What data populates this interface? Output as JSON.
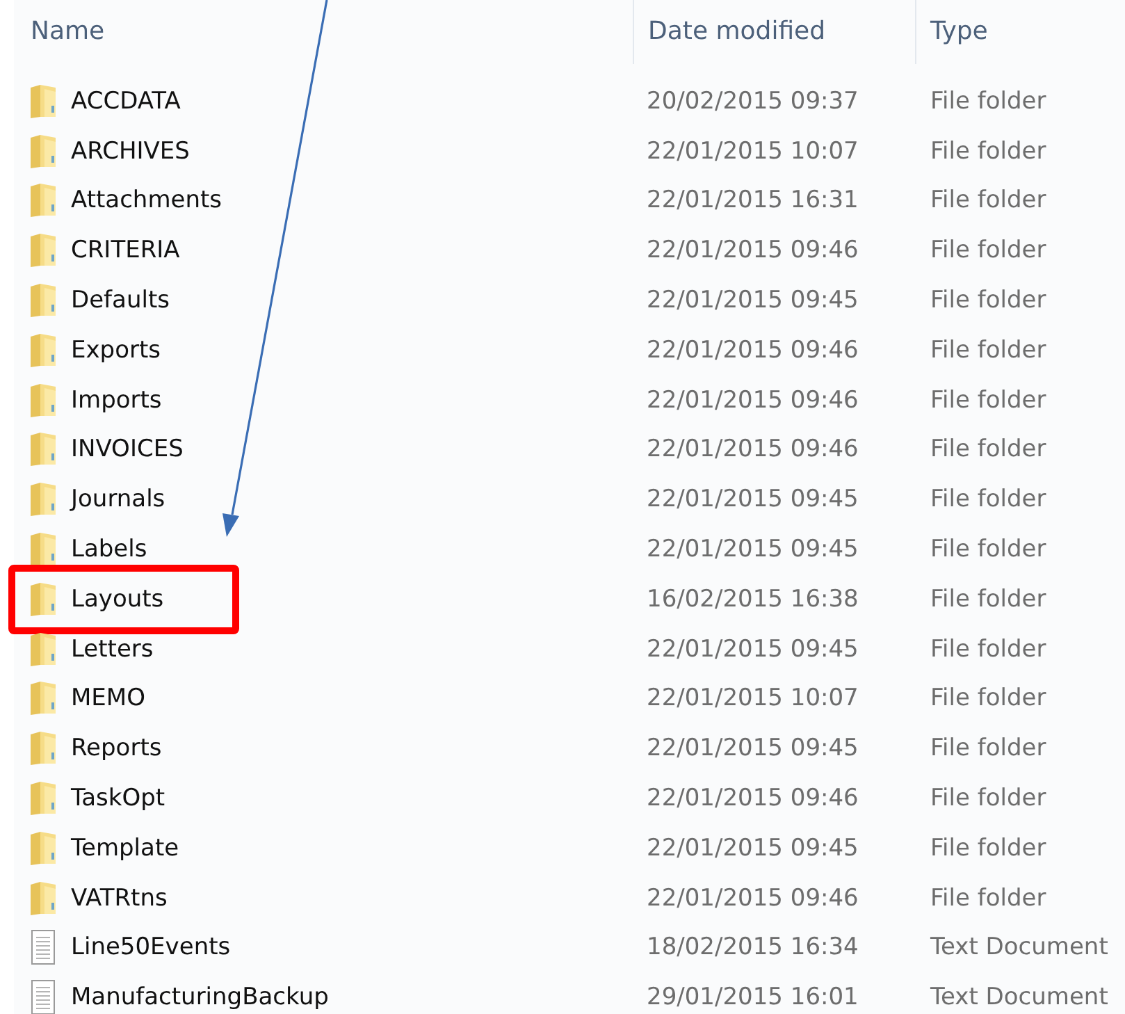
{
  "columns": [
    "Name",
    "Date modified",
    "Type"
  ],
  "rows": [
    {
      "kind": "folder",
      "name": "ACCDATA",
      "date": "20/02/2015 09:37",
      "type": "File folder",
      "highlighted": false
    },
    {
      "kind": "folder",
      "name": "ARCHIVES",
      "date": "22/01/2015 10:07",
      "type": "File folder",
      "highlighted": false
    },
    {
      "kind": "folder",
      "name": "Attachments",
      "date": "22/01/2015 16:31",
      "type": "File folder",
      "highlighted": false
    },
    {
      "kind": "folder",
      "name": "CRITERIA",
      "date": "22/01/2015 09:46",
      "type": "File folder",
      "highlighted": false
    },
    {
      "kind": "folder",
      "name": "Defaults",
      "date": "22/01/2015 09:45",
      "type": "File folder",
      "highlighted": false
    },
    {
      "kind": "folder",
      "name": "Exports",
      "date": "22/01/2015 09:46",
      "type": "File folder",
      "highlighted": false
    },
    {
      "kind": "folder",
      "name": "Imports",
      "date": "22/01/2015 09:46",
      "type": "File folder",
      "highlighted": false
    },
    {
      "kind": "folder",
      "name": "INVOICES",
      "date": "22/01/2015 09:46",
      "type": "File folder",
      "highlighted": false
    },
    {
      "kind": "folder",
      "name": "Journals",
      "date": "22/01/2015 09:45",
      "type": "File folder",
      "highlighted": false
    },
    {
      "kind": "folder",
      "name": "Labels",
      "date": "22/01/2015 09:45",
      "type": "File folder",
      "highlighted": false
    },
    {
      "kind": "folder",
      "name": "Layouts",
      "date": "16/02/2015 16:38",
      "type": "File folder",
      "highlighted": true
    },
    {
      "kind": "folder",
      "name": "Letters",
      "date": "22/01/2015 09:45",
      "type": "File folder",
      "highlighted": false
    },
    {
      "kind": "folder",
      "name": "MEMO",
      "date": "22/01/2015 10:07",
      "type": "File folder",
      "highlighted": false
    },
    {
      "kind": "folder",
      "name": "Reports",
      "date": "22/01/2015 09:45",
      "type": "File folder",
      "highlighted": false
    },
    {
      "kind": "folder",
      "name": "TaskOpt",
      "date": "22/01/2015 09:46",
      "type": "File folder",
      "highlighted": false
    },
    {
      "kind": "folder",
      "name": "Template",
      "date": "22/01/2015 09:45",
      "type": "File folder",
      "highlighted": false
    },
    {
      "kind": "folder",
      "name": "VATRtns",
      "date": "22/01/2015 09:46",
      "type": "File folder",
      "highlighted": false
    },
    {
      "kind": "text",
      "name": "Line50Events",
      "date": "18/02/2015 16:34",
      "type": "Text Document",
      "highlighted": false
    },
    {
      "kind": "text",
      "name": "ManufacturingBackup",
      "date": "29/01/2015 16:01",
      "type": "Text Document",
      "highlighted": false
    }
  ]
}
